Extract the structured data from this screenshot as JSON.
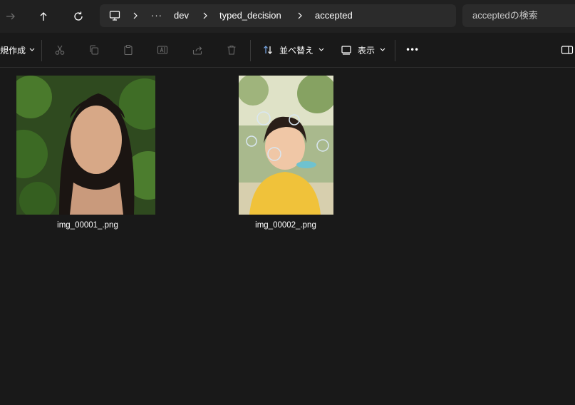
{
  "address": {
    "crumbs": [
      "dev",
      "typed_decision",
      "accepted"
    ],
    "ellipsis": "···"
  },
  "search": {
    "placeholder": "acceptedの検索"
  },
  "toolbar": {
    "new_label": "規作成",
    "sort_label": "並べ替え",
    "view_label": "表示",
    "more_label": "•••"
  },
  "files": [
    {
      "name": "img_00001_.png"
    },
    {
      "name": "img_00002_.png"
    }
  ],
  "colors": {
    "background": "#191919",
    "address_bar": "#202020",
    "field": "#2b2b2b",
    "accent_icon": "#7aa9e8"
  }
}
